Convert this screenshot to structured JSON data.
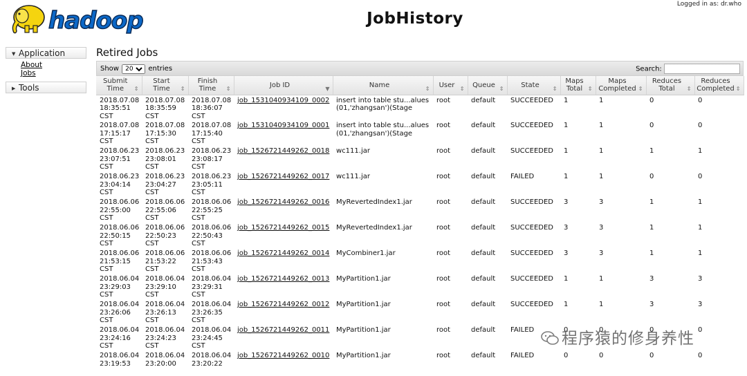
{
  "header": {
    "title": "JobHistory",
    "logged_in": "Logged in as: dr.who",
    "logo_text": "hadoop"
  },
  "nav": {
    "application": {
      "label": "Application",
      "links": [
        {
          "label": "About"
        },
        {
          "label": "Jobs"
        }
      ]
    },
    "tools": {
      "label": "Tools"
    }
  },
  "main": {
    "section_title": "Retired Jobs",
    "show_label": "Show",
    "entries_value": "20",
    "entries_label": "entries",
    "search_label": "Search:",
    "search_value": ""
  },
  "table": {
    "columns": [
      {
        "label": "Submit Time"
      },
      {
        "label": "Start Time"
      },
      {
        "label": "Finish Time"
      },
      {
        "label": "Job ID"
      },
      {
        "label": "Name"
      },
      {
        "label": "User"
      },
      {
        "label": "Queue"
      },
      {
        "label": "State"
      },
      {
        "label": "Maps Total"
      },
      {
        "label": "Maps Completed"
      },
      {
        "label": "Reduces Total"
      },
      {
        "label": "Reduces Completed"
      }
    ],
    "rows": [
      {
        "submit": "2018.07.08 18:35:51 CST",
        "start": "2018.07.08 18:35:59 CST",
        "finish": "2018.07.08 18:36:07 CST",
        "job_id": "job_1531040934109_0002",
        "name": "insert into table stu...alues (01,'zhangsan')(Stage",
        "user": "root",
        "queue": "default",
        "state": "SUCCEEDED",
        "maps_total": "1",
        "maps_completed": "1",
        "reduces_total": "0",
        "reduces_completed": "0"
      },
      {
        "submit": "2018.07.08 17:15:17 CST",
        "start": "2018.07.08 17:15:30 CST",
        "finish": "2018.07.08 17:15:40 CST",
        "job_id": "job_1531040934109_0001",
        "name": "insert into table stu...alues (01,'zhangsan')(Stage",
        "user": "root",
        "queue": "default",
        "state": "SUCCEEDED",
        "maps_total": "1",
        "maps_completed": "1",
        "reduces_total": "0",
        "reduces_completed": "0"
      },
      {
        "submit": "2018.06.23 23:07:51 CST",
        "start": "2018.06.23 23:08:01 CST",
        "finish": "2018.06.23 23:08:17 CST",
        "job_id": "job_1526721449262_0018",
        "name": "wc111.jar",
        "user": "root",
        "queue": "default",
        "state": "SUCCEEDED",
        "maps_total": "1",
        "maps_completed": "1",
        "reduces_total": "1",
        "reduces_completed": "1"
      },
      {
        "submit": "2018.06.23 23:04:14 CST",
        "start": "2018.06.23 23:04:27 CST",
        "finish": "2018.06.23 23:05:11 CST",
        "job_id": "job_1526721449262_0017",
        "name": "wc111.jar",
        "user": "root",
        "queue": "default",
        "state": "FAILED",
        "maps_total": "1",
        "maps_completed": "1",
        "reduces_total": "0",
        "reduces_completed": "0"
      },
      {
        "submit": "2018.06.06 22:55:00 CST",
        "start": "2018.06.06 22:55:06 CST",
        "finish": "2018.06.06 22:55:25 CST",
        "job_id": "job_1526721449262_0016",
        "name": "MyRevertedIndex1.jar",
        "user": "root",
        "queue": "default",
        "state": "SUCCEEDED",
        "maps_total": "3",
        "maps_completed": "3",
        "reduces_total": "1",
        "reduces_completed": "1"
      },
      {
        "submit": "2018.06.06 22:50:15 CST",
        "start": "2018.06.06 22:50:23 CST",
        "finish": "2018.06.06 22:50:43 CST",
        "job_id": "job_1526721449262_0015",
        "name": "MyRevertedIndex1.jar",
        "user": "root",
        "queue": "default",
        "state": "SUCCEEDED",
        "maps_total": "3",
        "maps_completed": "3",
        "reduces_total": "1",
        "reduces_completed": "1"
      },
      {
        "submit": "2018.06.06 21:53:15 CST",
        "start": "2018.06.06 21:53:22 CST",
        "finish": "2018.06.06 21:53:43 CST",
        "job_id": "job_1526721449262_0014",
        "name": "MyCombiner1.jar",
        "user": "root",
        "queue": "default",
        "state": "SUCCEEDED",
        "maps_total": "3",
        "maps_completed": "3",
        "reduces_total": "1",
        "reduces_completed": "1"
      },
      {
        "submit": "2018.06.04 23:29:03 CST",
        "start": "2018.06.04 23:29:10 CST",
        "finish": "2018.06.04 23:29:31 CST",
        "job_id": "job_1526721449262_0013",
        "name": "MyPartition1.jar",
        "user": "root",
        "queue": "default",
        "state": "SUCCEEDED",
        "maps_total": "1",
        "maps_completed": "1",
        "reduces_total": "3",
        "reduces_completed": "3"
      },
      {
        "submit": "2018.06.04 23:26:06 CST",
        "start": "2018.06.04 23:26:13 CST",
        "finish": "2018.06.04 23:26:35 CST",
        "job_id": "job_1526721449262_0012",
        "name": "MyPartition1.jar",
        "user": "root",
        "queue": "default",
        "state": "SUCCEEDED",
        "maps_total": "1",
        "maps_completed": "1",
        "reduces_total": "3",
        "reduces_completed": "3"
      },
      {
        "submit": "2018.06.04 23:24:16 CST",
        "start": "2018.06.04 23:24:23 CST",
        "finish": "2018.06.04 23:24:45 CST",
        "job_id": "job_1526721449262_0011",
        "name": "MyPartition1.jar",
        "user": "root",
        "queue": "default",
        "state": "FAILED",
        "maps_total": "0",
        "maps_completed": "0",
        "reduces_total": "0",
        "reduces_completed": "0"
      },
      {
        "submit": "2018.06.04 23:19:53",
        "start": "2018.06.04 23:20:00",
        "finish": "2018.06.04 23:20:22",
        "job_id": "job_1526721449262_0010",
        "name": "MyPartition1.jar",
        "user": "root",
        "queue": "default",
        "state": "FAILED",
        "maps_total": "0",
        "maps_completed": "0",
        "reduces_total": "0",
        "reduces_completed": "0"
      }
    ]
  },
  "watermark": {
    "text": "程序猿的修身养性",
    "icon": "wechat-icon"
  }
}
